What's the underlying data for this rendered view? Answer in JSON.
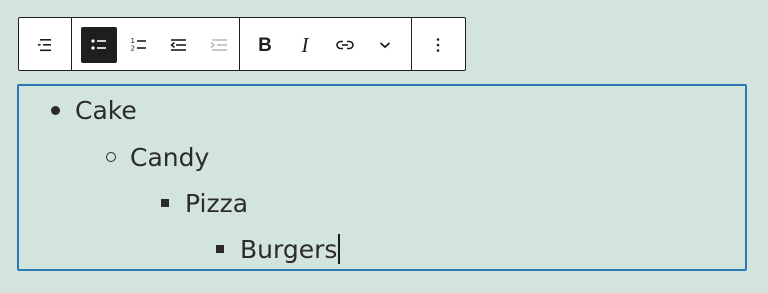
{
  "toolbar": {
    "buttons": [
      {
        "name": "list-block-icon",
        "label": "List"
      },
      {
        "name": "unordered-list-icon",
        "label": "Unordered",
        "active": true
      },
      {
        "name": "ordered-list-icon",
        "label": "Ordered"
      },
      {
        "name": "outdent-icon",
        "label": "Outdent"
      },
      {
        "name": "indent-icon",
        "label": "Indent",
        "disabled": true
      },
      {
        "name": "bold",
        "text": "B"
      },
      {
        "name": "italic",
        "text": "I"
      },
      {
        "name": "link-icon",
        "label": "Link"
      },
      {
        "name": "chevron-down-icon",
        "label": "More"
      },
      {
        "name": "more-options-icon",
        "label": "Options"
      }
    ],
    "bold_label": "B",
    "italic_label": "I"
  },
  "list": {
    "items": [
      {
        "text": "Cake",
        "level": 1,
        "marker": "disc"
      },
      {
        "text": "Candy",
        "level": 2,
        "marker": "circle"
      },
      {
        "text": "Pizza",
        "level": 3,
        "marker": "square"
      },
      {
        "text": "Burgers",
        "level": 4,
        "marker": "square"
      }
    ]
  },
  "colors": {
    "background": "#d3e4dd",
    "focus_border": "#2b79b6",
    "toolbar_border": "#1e1e1e",
    "active_button": "#1e1e1e"
  }
}
